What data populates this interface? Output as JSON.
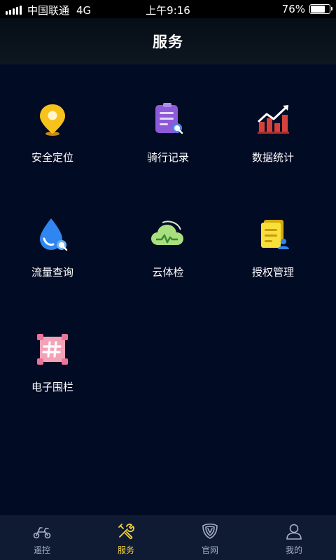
{
  "status_bar": {
    "carrier": "中国联通",
    "network": "4G",
    "time": "上午9:16",
    "battery": "76%",
    "battery_level": 0.76
  },
  "header": {
    "title": "服务"
  },
  "services": [
    {
      "label": "安全定位",
      "icon": "location-pin-icon"
    },
    {
      "label": "骑行记录",
      "icon": "ride-record-icon"
    },
    {
      "label": "数据统计",
      "icon": "data-chart-icon"
    },
    {
      "label": "流量查询",
      "icon": "data-flow-icon"
    },
    {
      "label": "云体检",
      "icon": "cloud-check-icon"
    },
    {
      "label": "授权管理",
      "icon": "authorization-icon"
    },
    {
      "label": "电子围栏",
      "icon": "geofence-icon"
    }
  ],
  "tabbar": {
    "items": [
      {
        "label": "遥控",
        "icon": "scooter-icon",
        "active": false
      },
      {
        "label": "服务",
        "icon": "tools-icon",
        "active": true
      },
      {
        "label": "官网",
        "icon": "shield-icon",
        "active": false
      },
      {
        "label": "我的",
        "icon": "user-icon",
        "active": false
      }
    ],
    "active_color": "#f3d23a",
    "inactive_color": "#a7b0c4"
  }
}
